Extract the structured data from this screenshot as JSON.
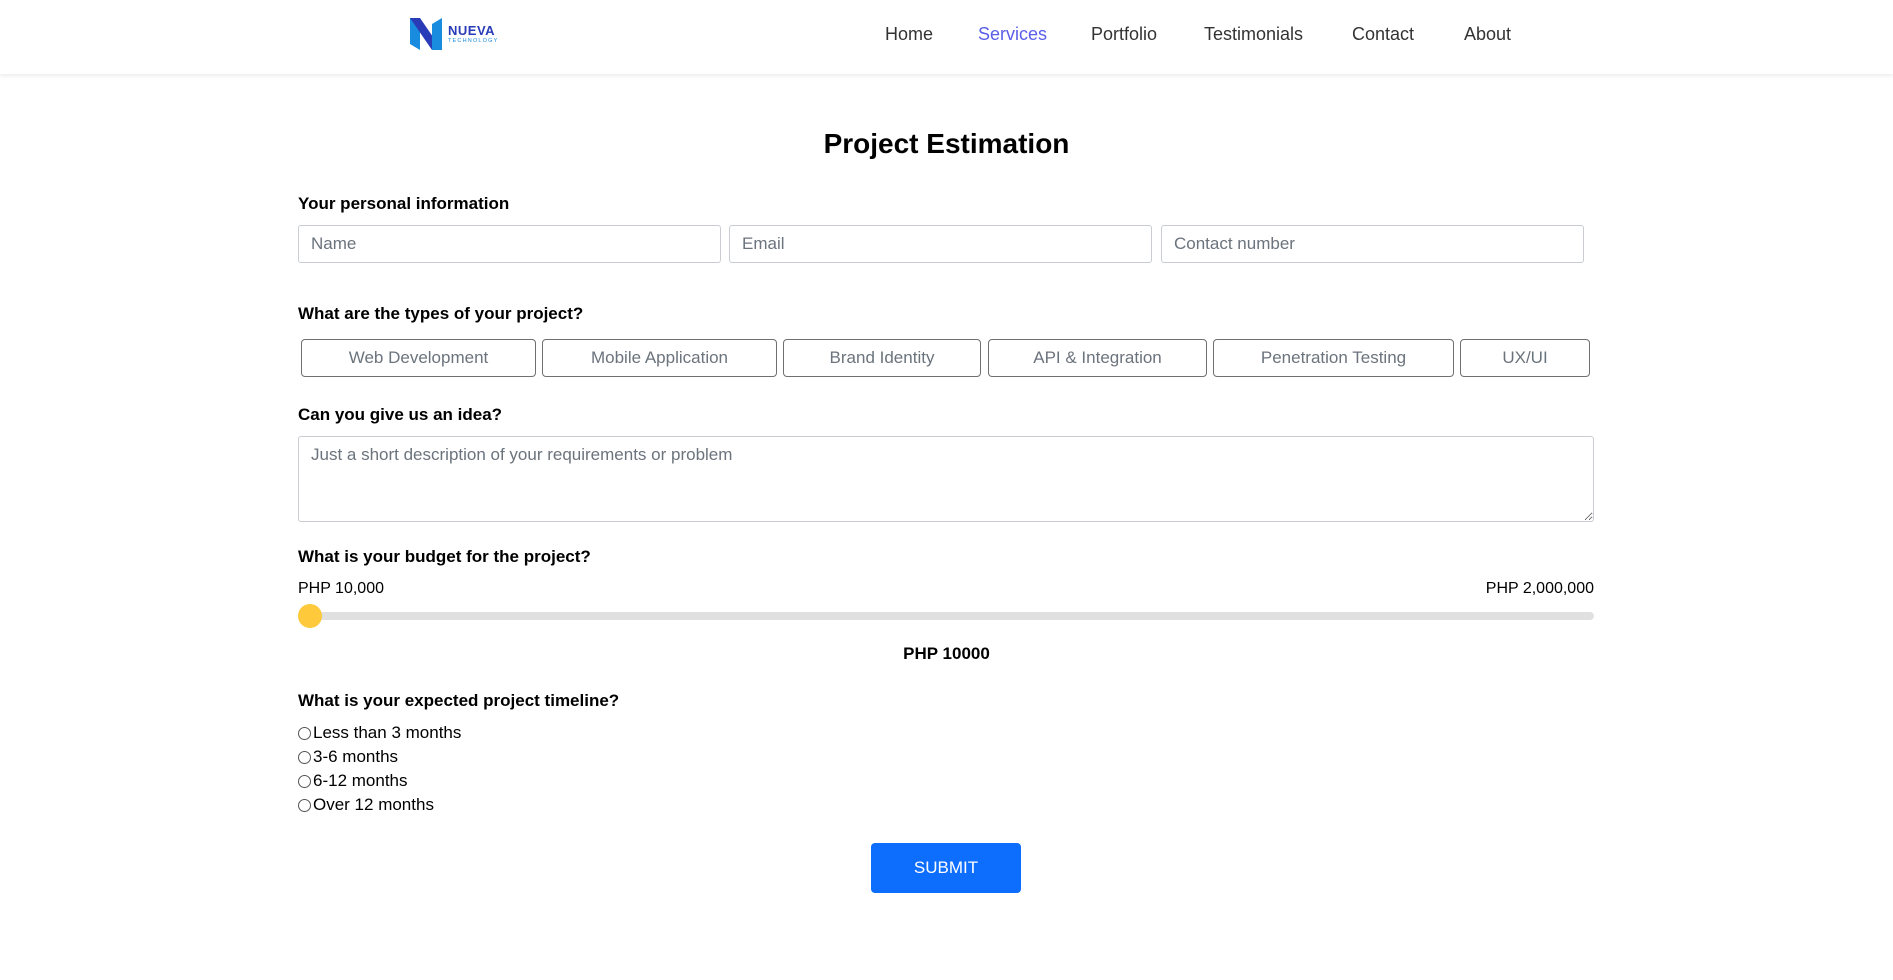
{
  "brand": {
    "name": "NUEVA",
    "tagline": "TECHNOLOGY",
    "colors": {
      "primary": "#2a3bb8",
      "secondary": "#1a8cdf"
    }
  },
  "nav": {
    "items": [
      {
        "label": "Home",
        "active": false
      },
      {
        "label": "Services",
        "active": true
      },
      {
        "label": "Portfolio",
        "active": false
      },
      {
        "label": "Testimonials",
        "active": false
      },
      {
        "label": "Contact",
        "active": false
      },
      {
        "label": "About",
        "active": false
      }
    ],
    "active_color": "#5a5ee8"
  },
  "page": {
    "title": "Project Estimation"
  },
  "personal": {
    "label": "Your personal information",
    "name_placeholder": "Name",
    "email_placeholder": "Email",
    "contact_placeholder": "Contact number"
  },
  "types": {
    "label": "What are the types of your project?",
    "options": [
      "Web Development",
      "Mobile Application",
      "Brand Identity",
      "API & Integration",
      "Penetration Testing",
      "UX/UI"
    ]
  },
  "idea": {
    "label": "Can you give us an idea?",
    "placeholder": "Just a short description of your requirements or problem"
  },
  "budget": {
    "label": "What is your budget for the project?",
    "min_label": "PHP 10,000",
    "max_label": "PHP 2,000,000",
    "min": 10000,
    "max": 2000000,
    "value": 10000,
    "value_label": "PHP 10000",
    "thumb_color": "#ffc93c"
  },
  "timeline": {
    "label": "What is your expected project timeline?",
    "options": [
      "Less than 3 months",
      "3-6 months",
      "6-12 months",
      "Over 12 months"
    ]
  },
  "submit": {
    "label": "SUBMIT",
    "color": "#0d6efd"
  }
}
